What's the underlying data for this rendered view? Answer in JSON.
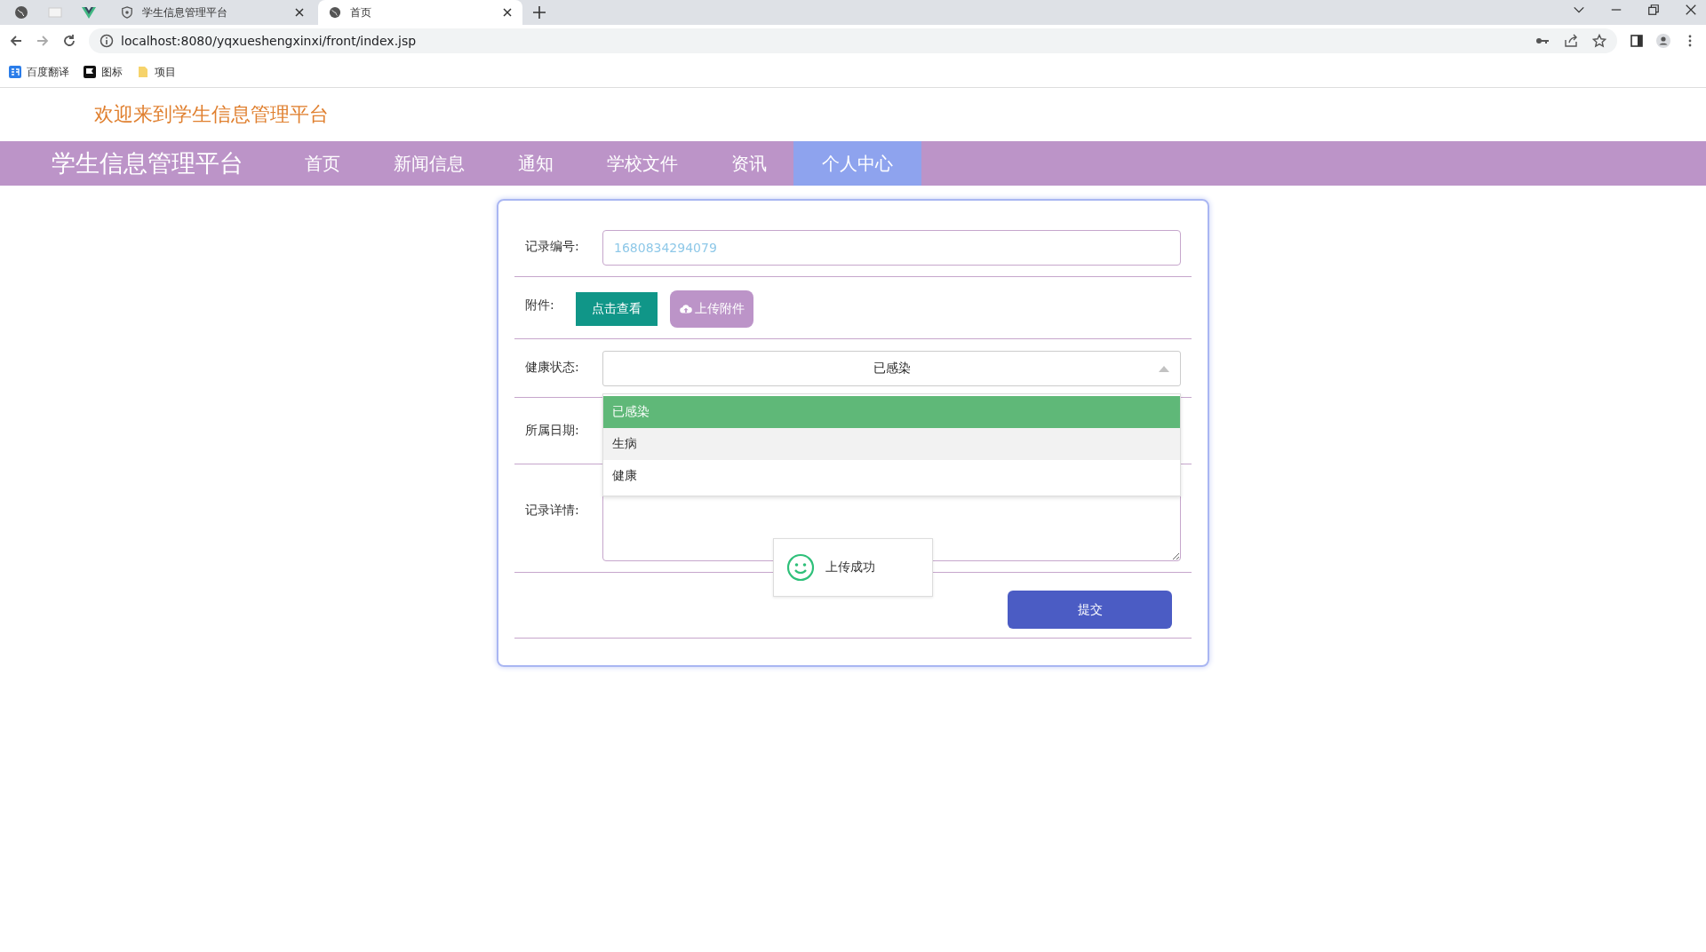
{
  "browser": {
    "tabs": [
      {
        "title": "学生信息管理平台",
        "selected": false
      },
      {
        "title": "首页",
        "selected": true
      }
    ],
    "url": "localhost:8080/yqxueshengxinxi/front/index.jsp",
    "bookmarks": [
      "百度翻译",
      "图标",
      "项目"
    ]
  },
  "header": {
    "welcome": "欢迎来到学生信息管理平台"
  },
  "nav": {
    "brand": "学生信息管理平台",
    "items": [
      {
        "label": "首页",
        "selected": false
      },
      {
        "label": "新闻信息",
        "selected": false
      },
      {
        "label": "通知",
        "selected": false
      },
      {
        "label": "学校文件",
        "selected": false
      },
      {
        "label": "资讯",
        "selected": false
      },
      {
        "label": "个人中心",
        "selected": true
      }
    ]
  },
  "form": {
    "fields": [
      {
        "kind": "input",
        "label": "记录编号:",
        "value": "1680834294079"
      },
      {
        "kind": "attachment",
        "label": "附件:",
        "view_button": "点击查看",
        "upload_button": "上传附件"
      },
      {
        "kind": "select",
        "label": "健康状态:",
        "value": "已感染",
        "expanded": true,
        "options": [
          {
            "label": "已感染",
            "selected": true,
            "hovered": false
          },
          {
            "label": "生病",
            "selected": false,
            "hovered": true
          },
          {
            "label": "健康",
            "selected": false,
            "hovered": false
          }
        ]
      },
      {
        "kind": "date",
        "label": "所属日期:"
      },
      {
        "kind": "textarea",
        "label": "记录详情:"
      }
    ],
    "submit": "提交"
  },
  "toast": {
    "text": "上传成功"
  }
}
